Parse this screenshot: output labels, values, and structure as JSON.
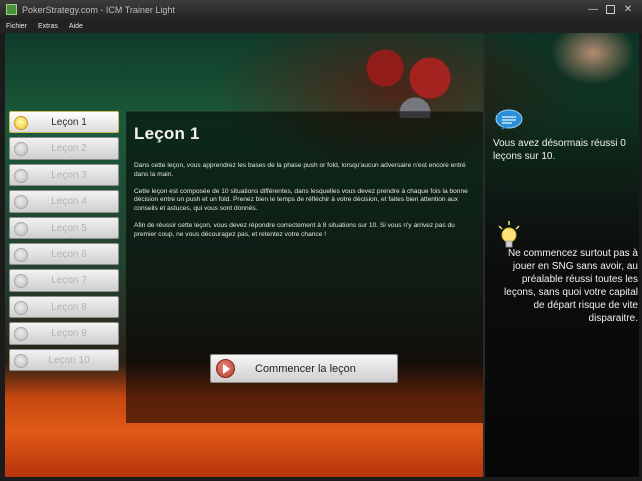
{
  "window": {
    "title": "PokerStrategy.com - ICM Trainer Light"
  },
  "menu": {
    "items": [
      "Fichier",
      "Extras",
      "Aide"
    ]
  },
  "lessons": [
    {
      "label": "Leçon 1",
      "active": true
    },
    {
      "label": "Leçon 2",
      "active": false
    },
    {
      "label": "Leçon 3",
      "active": false
    },
    {
      "label": "Leçon 4",
      "active": false
    },
    {
      "label": "Leçon 5",
      "active": false
    },
    {
      "label": "Leçon 6",
      "active": false
    },
    {
      "label": "Leçon 7",
      "active": false
    },
    {
      "label": "Leçon 8",
      "active": false
    },
    {
      "label": "Leçon 9",
      "active": false
    },
    {
      "label": "Leçon 10",
      "active": false
    }
  ],
  "lesson_panel": {
    "title": "Leçon 1",
    "paragraphs": [
      "Dans cette leçon, vous apprendrez les bases de la phase push or fold, lorsqu'aucun adversaire n'est encore entré dans la main.",
      "Cette leçon est composée de 10 situations différentes, dans lesquelles vous devez prendre à chaque fois la bonne décision entre un push et un fold. Prenez bien le temps de réfléchir à votre décision, et faites bien attention aux conseils et astuces, qui vous sont donnés.",
      "Afin de réussir cette leçon, vous devez répondre correctement à 8 situations sur 10. Si vous n'y arrivez pas du premier coup, ne vous découragez pas, et retentez votre chance !"
    ],
    "start_button": "Commencer la leçon"
  },
  "info": {
    "success_text": "Vous avez désormais réussi 0 leçons sur 10.",
    "tip_text": "Ne commencez surtout pas à jouer en SNG sans avoir, au préalable réussi toutes les leçons, sans quoi votre capital de départ risque de vite disparaitre."
  },
  "icons": {
    "app": "app-icon",
    "bubble": "speech-bubble-icon",
    "bulb": "lightbulb-icon",
    "play": "play-icon"
  },
  "colors": {
    "accent_active": "#f0c22e",
    "play": "#b23a2c",
    "bubble": "#2a8fd6"
  }
}
